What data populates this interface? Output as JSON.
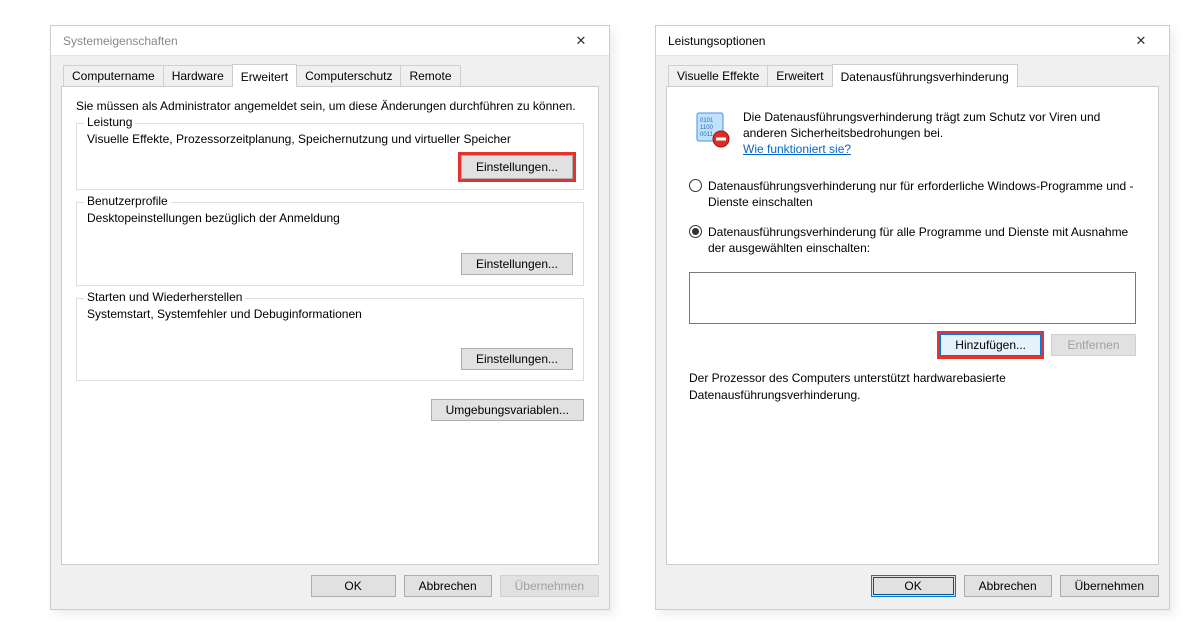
{
  "left_dialog": {
    "title": "Systemeigenschaften",
    "tabs": [
      "Computername",
      "Hardware",
      "Erweitert",
      "Computerschutz",
      "Remote"
    ],
    "active_tab": 2,
    "admin_note": "Sie müssen als Administrator angemeldet sein, um diese Änderungen durchführen zu können.",
    "groups": {
      "performance": {
        "legend": "Leistung",
        "desc": "Visuelle Effekte, Prozessorzeitplanung, Speichernutzung und virtueller Speicher",
        "button": "Einstellungen..."
      },
      "profiles": {
        "legend": "Benutzerprofile",
        "desc": "Desktopeinstellungen bezüglich der Anmeldung",
        "button": "Einstellungen..."
      },
      "startup": {
        "legend": "Starten und Wiederherstellen",
        "desc": "Systemstart, Systemfehler und Debuginformationen",
        "button": "Einstellungen..."
      }
    },
    "env_button": "Umgebungsvariablen...",
    "buttons": {
      "ok": "OK",
      "cancel": "Abbrechen",
      "apply": "Übernehmen"
    }
  },
  "right_dialog": {
    "title": "Leistungsoptionen",
    "tabs": [
      "Visuelle Effekte",
      "Erweitert",
      "Datenausführungsverhinderung"
    ],
    "active_tab": 2,
    "intro": "Die Datenausführungsverhinderung trägt zum Schutz vor Viren und anderen Sicherheitsbedrohungen bei.",
    "intro_link": "Wie funktioniert sie?",
    "radio1": "Datenausführungsverhinderung nur für erforderliche Windows-Programme und -Dienste einschalten",
    "radio2": "Datenausführungsverhinderung für alle Programme und Dienste mit Ausnahme der ausgewählten einschalten:",
    "selected_radio": 2,
    "add_button": "Hinzufügen...",
    "remove_button": "Entfernen",
    "status": "Der Prozessor des Computers unterstützt hardwarebasierte Datenausführungsverhinderung.",
    "buttons": {
      "ok": "OK",
      "cancel": "Abbrechen",
      "apply": "Übernehmen"
    }
  }
}
